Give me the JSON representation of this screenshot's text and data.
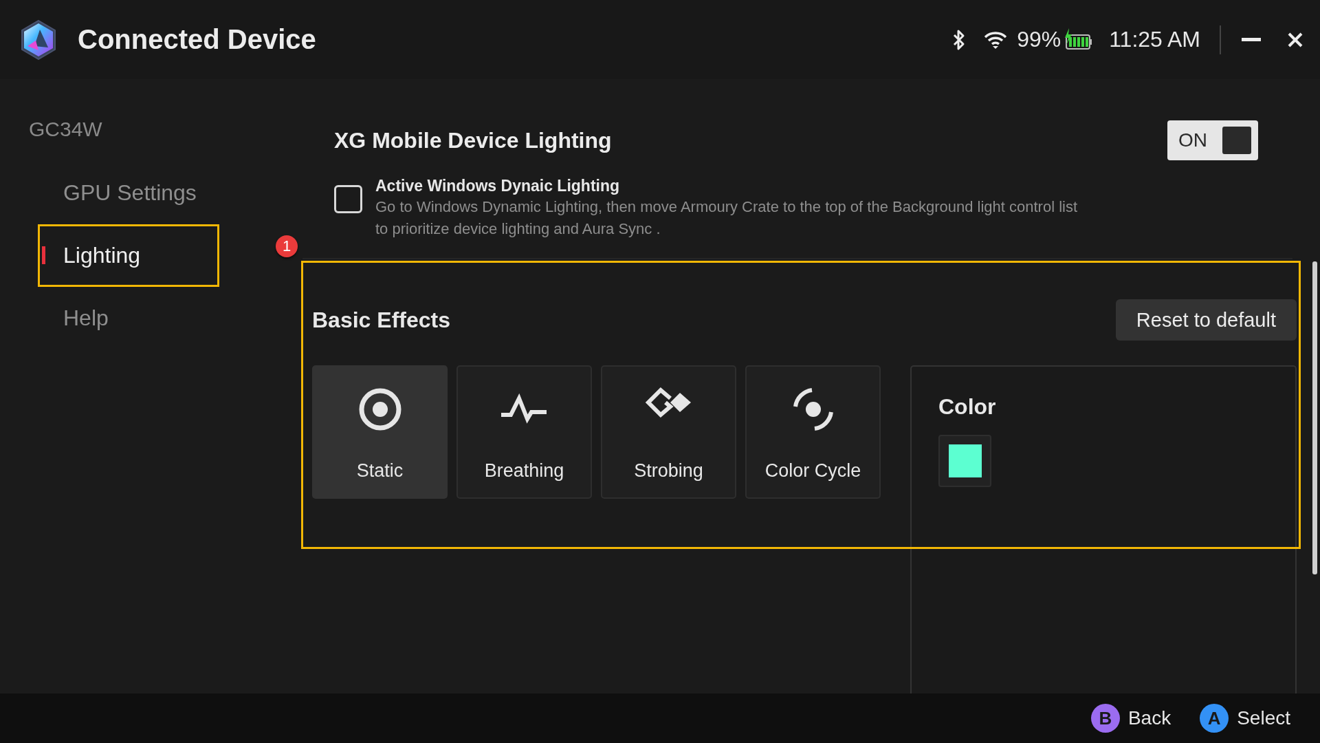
{
  "window": {
    "title": "Connected Device"
  },
  "status": {
    "battery_percent": "99%",
    "time": "11:25 AM"
  },
  "sidebar": {
    "device": "GC34W",
    "items": [
      {
        "label": "GPU Settings",
        "selected": false,
        "highlighted": false
      },
      {
        "label": "Lighting",
        "selected": true,
        "highlighted": true
      },
      {
        "label": "Help",
        "selected": false,
        "highlighted": false
      }
    ]
  },
  "annotation_badge": "1",
  "lighting": {
    "title": "XG Mobile Device Lighting",
    "toggle": {
      "label": "ON",
      "on": true
    },
    "dynamic_lighting": {
      "checked": false,
      "title": "Active Windows Dynaic Lighting",
      "description": "Go to Windows Dynamic Lighting, then move Armoury Crate to the top of the Background light control list to prioritize device lighting and Aura Sync ."
    }
  },
  "basic_effects": {
    "title": "Basic Effects",
    "highlighted": true,
    "reset_button": "Reset to default",
    "effects": [
      {
        "kind": "static",
        "label": "Static",
        "selected": true
      },
      {
        "kind": "breathing",
        "label": "Breathing",
        "selected": false
      },
      {
        "kind": "strobing",
        "label": "Strobing",
        "selected": false
      },
      {
        "kind": "color_cycle",
        "label": "Color Cycle",
        "selected": false
      }
    ],
    "color_panel": {
      "title": "Color",
      "color": "#5cffd1"
    }
  },
  "footer": {
    "hints": [
      {
        "key": "B",
        "label": "Back",
        "color": "#9b6cf0"
      },
      {
        "key": "A",
        "label": "Select",
        "color": "#3391f5"
      }
    ]
  }
}
